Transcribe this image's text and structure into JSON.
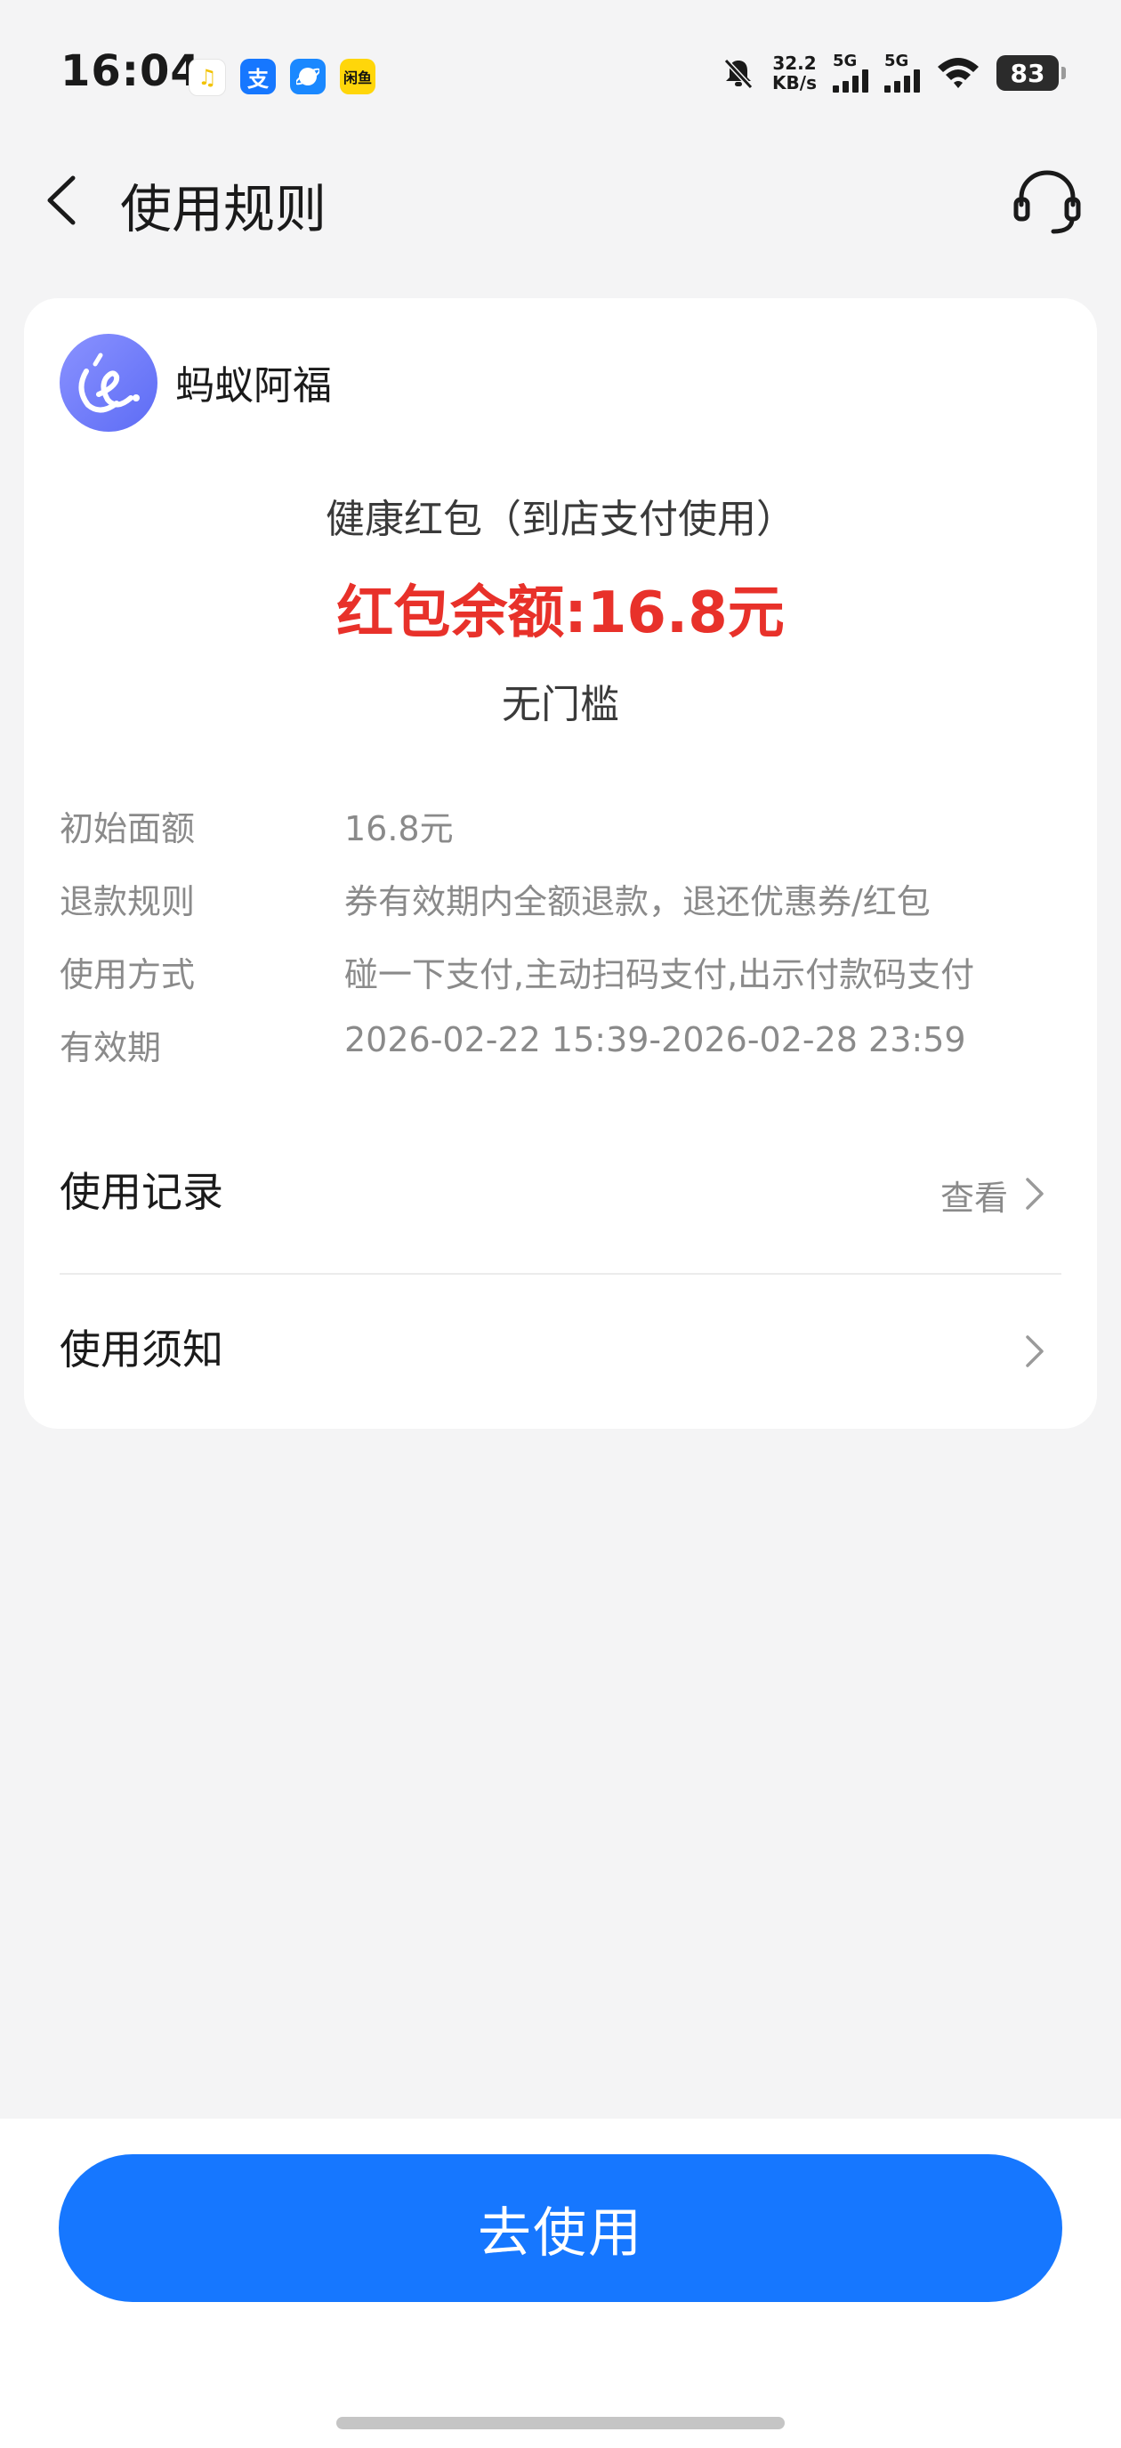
{
  "status_bar": {
    "time": "16:04",
    "net_speed_value": "32.2",
    "net_speed_unit": "KB/s",
    "signal_1_label": "5G",
    "signal_2_label": "5G",
    "battery": "83",
    "app_icons": [
      "music-app-icon",
      "alipay-icon",
      "browser-icon",
      "yellow-app-icon"
    ],
    "alipay_glyph": "支",
    "yellow_app_glyph": "闲鱼"
  },
  "header": {
    "title": "使用规则"
  },
  "card": {
    "brand_name": "蚂蚁阿福",
    "coupon_title": "健康红包（到店支付使用）",
    "coupon_balance": "红包余额:16.8元",
    "coupon_threshold": "无门槛",
    "info": [
      {
        "label": "初始面额",
        "value": "16.8元"
      },
      {
        "label": "退款规则",
        "value": "券有效期内全额退款，退还优惠券/红包"
      },
      {
        "label": "使用方式",
        "value": "碰一下支付,主动扫码支付,出示付款码支付"
      },
      {
        "label": "有效期",
        "value": "2026-02-22 15:39-2026-02-28 23:59"
      }
    ],
    "usage_record": {
      "label": "使用记录",
      "action": "查看"
    },
    "usage_notice": {
      "label": "使用须知"
    }
  },
  "bottom": {
    "primary_button": "去使用"
  },
  "colors": {
    "accent_blue": "#1677ff",
    "balance_red": "#e8312a",
    "background": "#f4f4f5"
  }
}
